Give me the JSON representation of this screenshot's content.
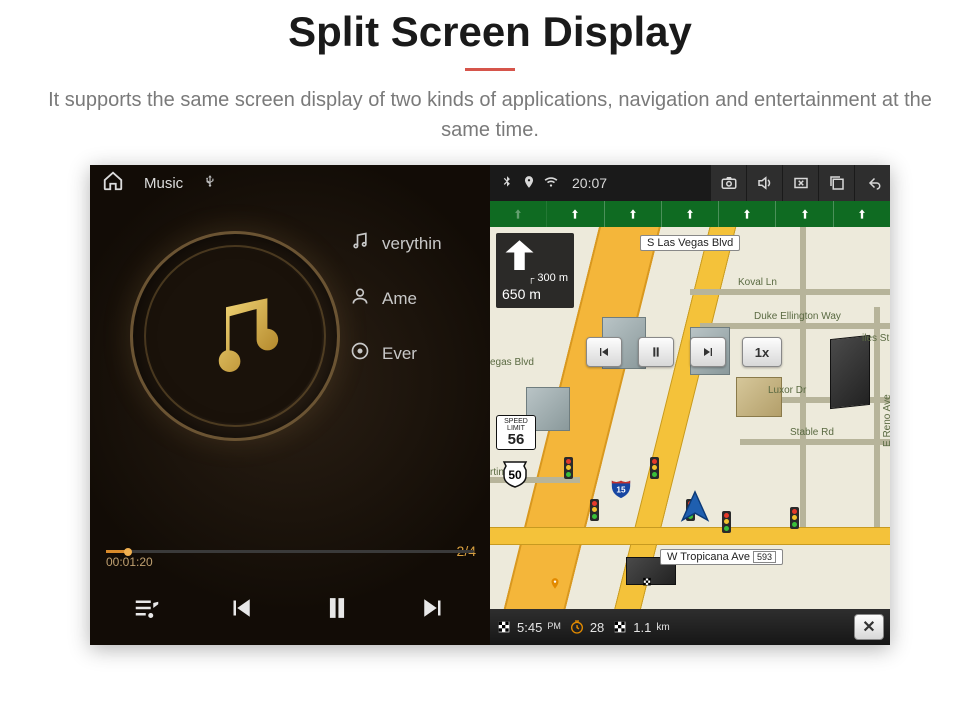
{
  "page": {
    "title": "Split Screen Display",
    "subtitle": "It supports the same screen display of two kinds of applications, navigation and entertainment at the same time."
  },
  "music": {
    "statusbar": {
      "title": "Music"
    },
    "tracks": {
      "now_playing": "verythin",
      "artist": "Ame",
      "album": "Ever"
    },
    "progress": {
      "elapsed": "00:01:20",
      "counter": "2/4"
    },
    "controls": {}
  },
  "nav": {
    "statusbar": {
      "time": "20:07"
    },
    "turn": {
      "next_dist": "300 m",
      "total_dist": "650 m"
    },
    "speed_limit": {
      "label_top": "SPEED",
      "label_mid": "LIMIT",
      "value": "56"
    },
    "route_shield": "50",
    "interstate_shield": "15",
    "streets": {
      "s_las_vegas": "S Las Vegas Blvd",
      "koval": "Koval Ln",
      "duke": "Duke Ellington Way",
      "giles": "iles St",
      "luxor": "Luxor Dr",
      "reno": "E Reno Ave",
      "stable": "Stable Rd",
      "martin": "rtin Dr",
      "tropicana": "W Tropicana Ave",
      "tropicana_exit": "593",
      "vegas_blvd_short": "egas Blvd"
    },
    "map_controls": {
      "speed_factor": "1x"
    },
    "footer": {
      "eta": "5:45",
      "remaining_time": "28",
      "remaining_dist": "1.1",
      "remaining_dist_unit": "km"
    }
  }
}
